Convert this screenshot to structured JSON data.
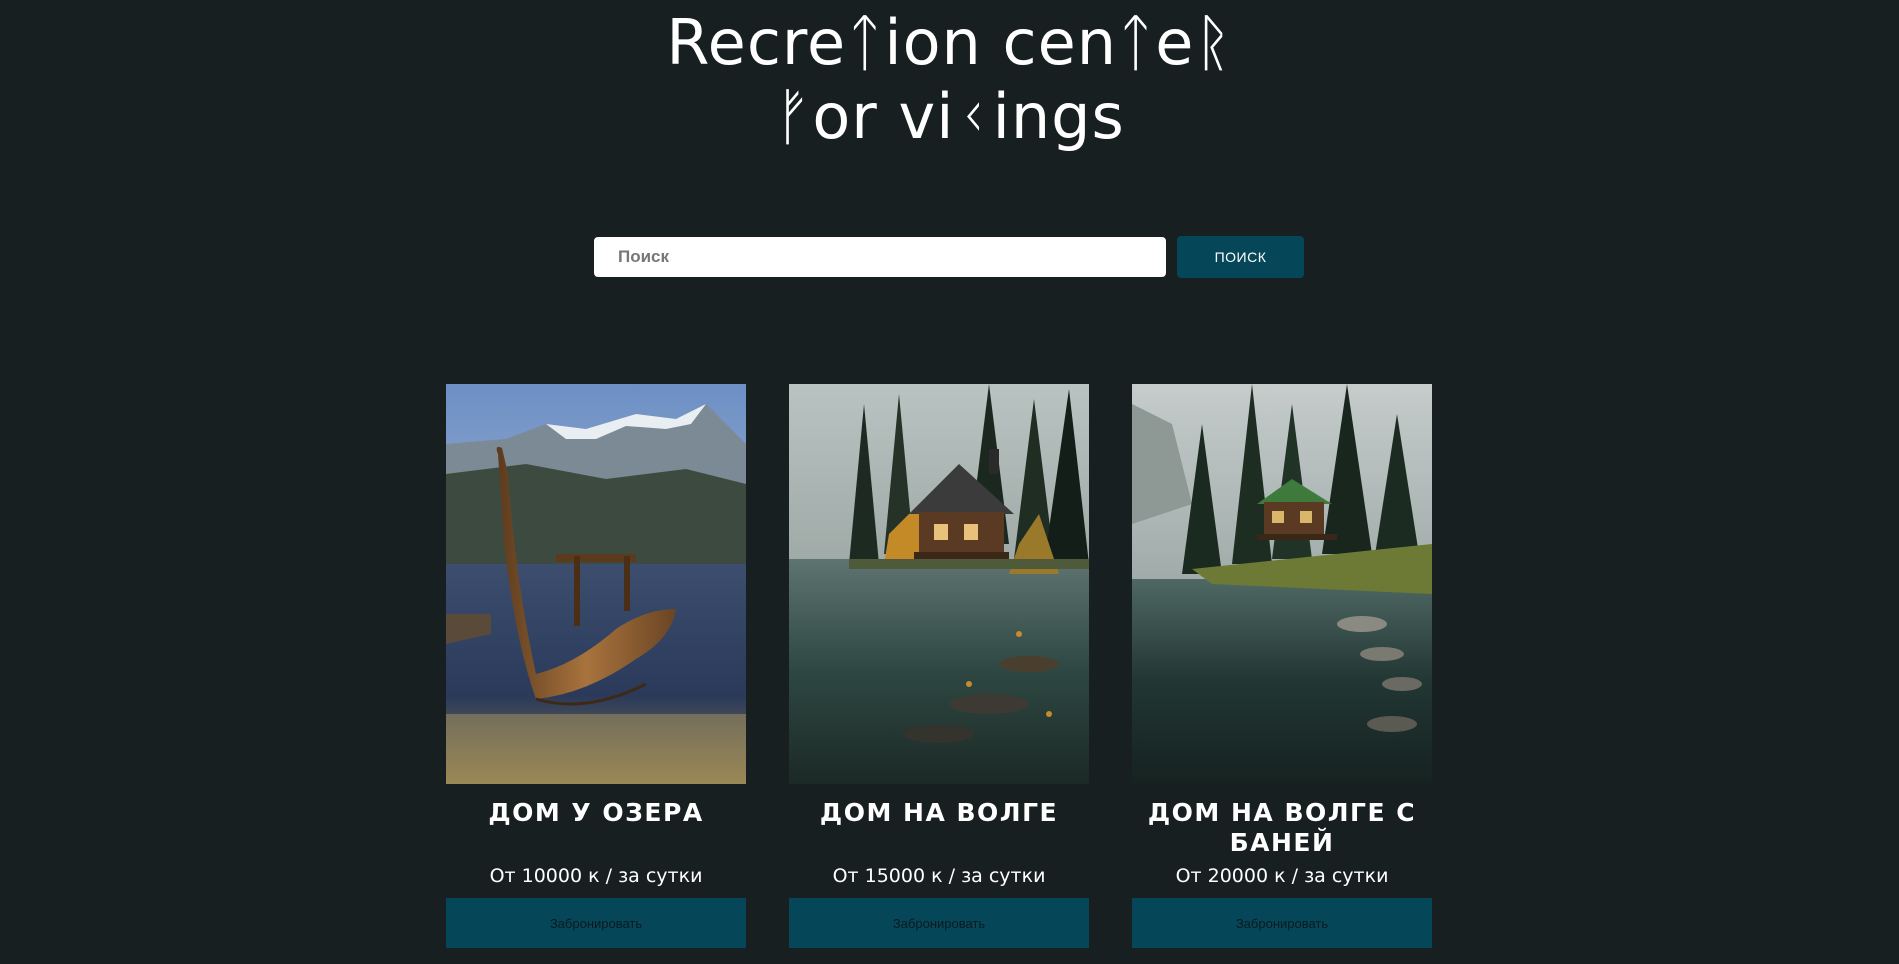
{
  "header": {
    "title_line1": "Recreᛏion cenᛏeᚱ",
    "title_line2": "ᚠor viᚲings"
  },
  "search": {
    "placeholder": "Поиск",
    "button_label": "ПОИСК"
  },
  "cards": [
    {
      "title": "ДОМ У ОЗЕРА",
      "price": "От 10000 к / за сутки",
      "book_label": "Забронировать",
      "image": "viking-longship-on-mountain-lake"
    },
    {
      "title": "ДОМ НА ВОЛГЕ",
      "price": "От 15000 к / за сутки",
      "book_label": "Забронировать",
      "image": "log-cabin-by-forest-lake"
    },
    {
      "title": "ДОМ НА ВОЛГЕ С БАНЕЙ",
      "price": "От 20000 к / за сутки",
      "book_label": "Забронировать",
      "image": "wooden-house-with-green-roof-by-lake"
    }
  ],
  "colors": {
    "background": "#181f21",
    "accent": "#054759",
    "text": "#ffffff"
  }
}
